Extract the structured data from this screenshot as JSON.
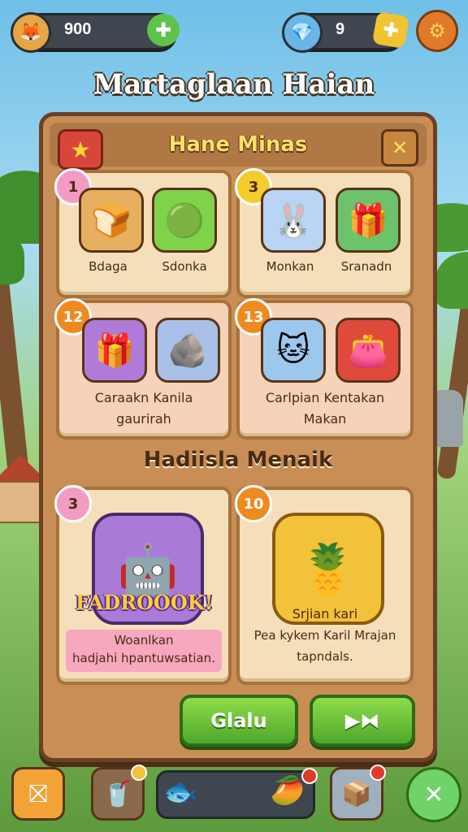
{
  "hud": {
    "coins": "900",
    "gems": "9",
    "coin_icon": "fox-coin-icon",
    "gem_icon": "blue-gem-icon"
  },
  "page_title": "Martaglaan Haian",
  "panel": {
    "title": "Hane Minas",
    "cards_top": [
      {
        "badge": "1",
        "items": [
          {
            "label": "Bdaga",
            "icon": "bread-bag-icon"
          },
          {
            "label": "Sdonka",
            "icon": "green-slime-icon"
          }
        ]
      },
      {
        "badge": "3",
        "items": [
          {
            "label": "Monkan",
            "icon": "bunny-icon"
          },
          {
            "label": "Sranadn",
            "icon": "gift-box-icon"
          }
        ]
      }
    ],
    "cards_mid": [
      {
        "badge": "12",
        "line1": "Caraakn Kanila",
        "line2": "gaurirah"
      },
      {
        "badge": "13",
        "line1": "Carlpian Kentakan",
        "line2": "Makan"
      }
    ],
    "section_title": "Hadiisla Menaik",
    "cards_bottom": [
      {
        "badge": "3",
        "brand": "FADROOOK!",
        "line1": "Woanlkan",
        "line2": "hadjahi hpantuwsatian."
      },
      {
        "badge": "10",
        "line1": "Srjian kari",
        "line2": "Pea kykem Karil Mrajan",
        "line3": "tapndals."
      }
    ],
    "primary_button": "Glalu",
    "skip_button": "▶⧓"
  },
  "colors": {
    "panel": "#c98e56",
    "accent_green": "#5fc24a",
    "title_yellow": "#ffe066"
  }
}
